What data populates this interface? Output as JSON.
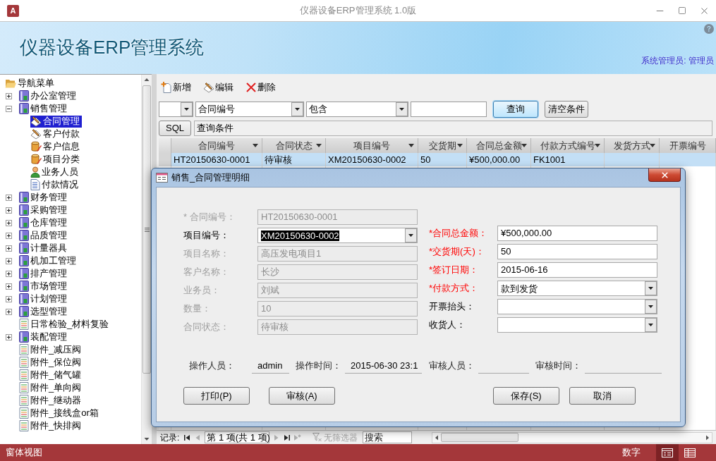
{
  "window": {
    "app_icon": "A",
    "title": "仪器设备ERP管理系统 1.0版"
  },
  "banner": {
    "title": "仪器设备ERP管理系统",
    "user": "系统管理员: 管理员"
  },
  "nav": {
    "items": [
      {
        "label": "导航菜单",
        "kind": "root",
        "selected": false,
        "children": [
          {
            "label": "办公室管理",
            "kind": "module",
            "selected": false,
            "expanded": false
          },
          {
            "label": "销售管理",
            "kind": "module",
            "selected": false,
            "expanded": true,
            "children": [
              {
                "label": "合同管理",
                "kind": "form",
                "selected": true
              },
              {
                "label": "客户付款",
                "kind": "form",
                "selected": false
              },
              {
                "label": "客户信息",
                "kind": "table",
                "selected": false
              },
              {
                "label": "项目分类",
                "kind": "table",
                "selected": false
              },
              {
                "label": "业务人员",
                "kind": "person",
                "selected": false
              },
              {
                "label": "付款情况",
                "kind": "report",
                "selected": false
              }
            ]
          },
          {
            "label": "财务管理",
            "kind": "module",
            "selected": false,
            "expanded": false
          },
          {
            "label": "采购管理",
            "kind": "module",
            "selected": false,
            "expanded": false
          },
          {
            "label": "仓库管理",
            "kind": "module",
            "selected": false,
            "expanded": false
          },
          {
            "label": "品质管理",
            "kind": "module",
            "selected": false,
            "expanded": false
          },
          {
            "label": "计量器具",
            "kind": "module",
            "selected": false,
            "expanded": false
          },
          {
            "label": "机加工管理",
            "kind": "module",
            "selected": false,
            "expanded": false
          },
          {
            "label": "排产管理",
            "kind": "module",
            "selected": false,
            "expanded": false
          },
          {
            "label": "市场管理",
            "kind": "module",
            "selected": false,
            "expanded": false
          },
          {
            "label": "计划管理",
            "kind": "module",
            "selected": false,
            "expanded": false
          },
          {
            "label": "选型管理",
            "kind": "module",
            "selected": false,
            "expanded": false
          },
          {
            "label": "日常检验_材料复验",
            "kind": "list",
            "selected": false
          },
          {
            "label": "装配管理",
            "kind": "module",
            "selected": false,
            "expanded": false
          },
          {
            "label": "附件_减压阀",
            "kind": "list",
            "selected": false
          },
          {
            "label": "附件_保位阀",
            "kind": "list",
            "selected": false
          },
          {
            "label": "附件_储气罐",
            "kind": "list",
            "selected": false
          },
          {
            "label": "附件_单向阀",
            "kind": "list",
            "selected": false
          },
          {
            "label": "附件_继动器",
            "kind": "list",
            "selected": false
          },
          {
            "label": "附件_接线盒or箱",
            "kind": "list",
            "selected": false
          },
          {
            "label": "附件_快排阀",
            "kind": "list",
            "selected": false
          }
        ]
      }
    ]
  },
  "toolbar": [
    {
      "label": "新增",
      "kind": "new"
    },
    {
      "label": "编辑",
      "kind": "edit"
    },
    {
      "label": "删除",
      "kind": "delete"
    }
  ],
  "filter": {
    "controls": [
      {
        "kind": "combo"
      },
      {
        "kind": "combo",
        "value": "合同编号"
      },
      {
        "kind": "combo",
        "value": "包含"
      },
      {
        "kind": "text"
      }
    ],
    "buttons": [
      {
        "label": "查询",
        "focused": true
      },
      {
        "label": "清空条件",
        "focused": false
      }
    ],
    "sql_button": "SQL",
    "query": "查询条件"
  },
  "table": {
    "columns": [
      "合同编号",
      "合同状态",
      "项目编号",
      "交货期",
      "合同总金额",
      "付款方式编号",
      "发货方式",
      "开票编号"
    ],
    "rows": [
      {
        "selected": true,
        "cells": [
          "HT20150630-0001",
          "待审核",
          "XM20150630-0002",
          "50",
          "¥500,000.00",
          "FK1001"
        ]
      }
    ]
  },
  "dialog": {
    "title": "销售_合同管理明细",
    "left_fields": [
      {
        "label": "* 合同编号：",
        "value": "HT20150630-0001",
        "kind": "text",
        "disabled": true,
        "required": false
      },
      {
        "label": "项目编号：",
        "value": "XM20150630-0002",
        "kind": "combo",
        "disabled": false,
        "required": false,
        "focused": true
      },
      {
        "label": "项目名称：",
        "value": "高压发电项目1",
        "kind": "text",
        "disabled": true,
        "required": false
      },
      {
        "label": "客户名称：",
        "value": "长沙",
        "kind": "text",
        "disabled": true,
        "required": false
      },
      {
        "label": "业务员：",
        "value": "刘斌",
        "kind": "text",
        "disabled": true,
        "required": false
      },
      {
        "label": "数量：",
        "value": "10",
        "kind": "text",
        "disabled": true,
        "required": false
      },
      {
        "label": "合同状态：",
        "value": "待审核",
        "kind": "text",
        "disabled": true,
        "required": false
      }
    ],
    "right_fields": [
      {
        "label": "*合同总金额：",
        "value": "¥500,000.00",
        "kind": "text",
        "disabled": false,
        "required": true
      },
      {
        "label": "*交货期(天)：",
        "value": "50",
        "kind": "text",
        "disabled": false,
        "required": true
      },
      {
        "label": "*签订日期：",
        "value": "2015-06-16",
        "kind": "text",
        "disabled": false,
        "required": true
      },
      {
        "label": "*付款方式：",
        "value": "款到发货",
        "kind": "combo",
        "disabled": false,
        "required": true
      },
      {
        "label": "开票抬头：",
        "kind": "combo",
        "disabled": false,
        "required": false
      },
      {
        "label": "收货人：",
        "kind": "combo",
        "disabled": false,
        "required": false
      }
    ],
    "audit": [
      {
        "label": "操作人员：",
        "value": "admin"
      },
      {
        "label": "操作时间：",
        "value": "2015-06-30 23:1"
      },
      {
        "label": "审核人员："
      },
      {
        "label": "审核时间："
      }
    ],
    "buttons": [
      {
        "label": "打印(P)"
      },
      {
        "label": "审核(A)"
      },
      {
        "label": "保存(S)"
      },
      {
        "label": "取消"
      }
    ]
  },
  "record_nav": {
    "label": "记录:",
    "buttons": [
      {
        "kind": "first",
        "disabled": false
      },
      {
        "kind": "previous",
        "disabled": true
      },
      {
        "kind": "next",
        "disabled": true
      },
      {
        "kind": "last",
        "disabled": false
      },
      {
        "kind": "new",
        "disabled": true
      }
    ],
    "position": "第 1 项(共 1 项)",
    "filter": {
      "label": "无筛选器",
      "disabled": true
    },
    "search": {
      "placeholder": "搜索"
    }
  },
  "status_bar": {
    "mode": "窗体视图",
    "indicator": "数字",
    "views": [
      {
        "kind": "form",
        "selected": true
      },
      {
        "kind": "datasheet",
        "selected": false
      }
    ]
  }
}
